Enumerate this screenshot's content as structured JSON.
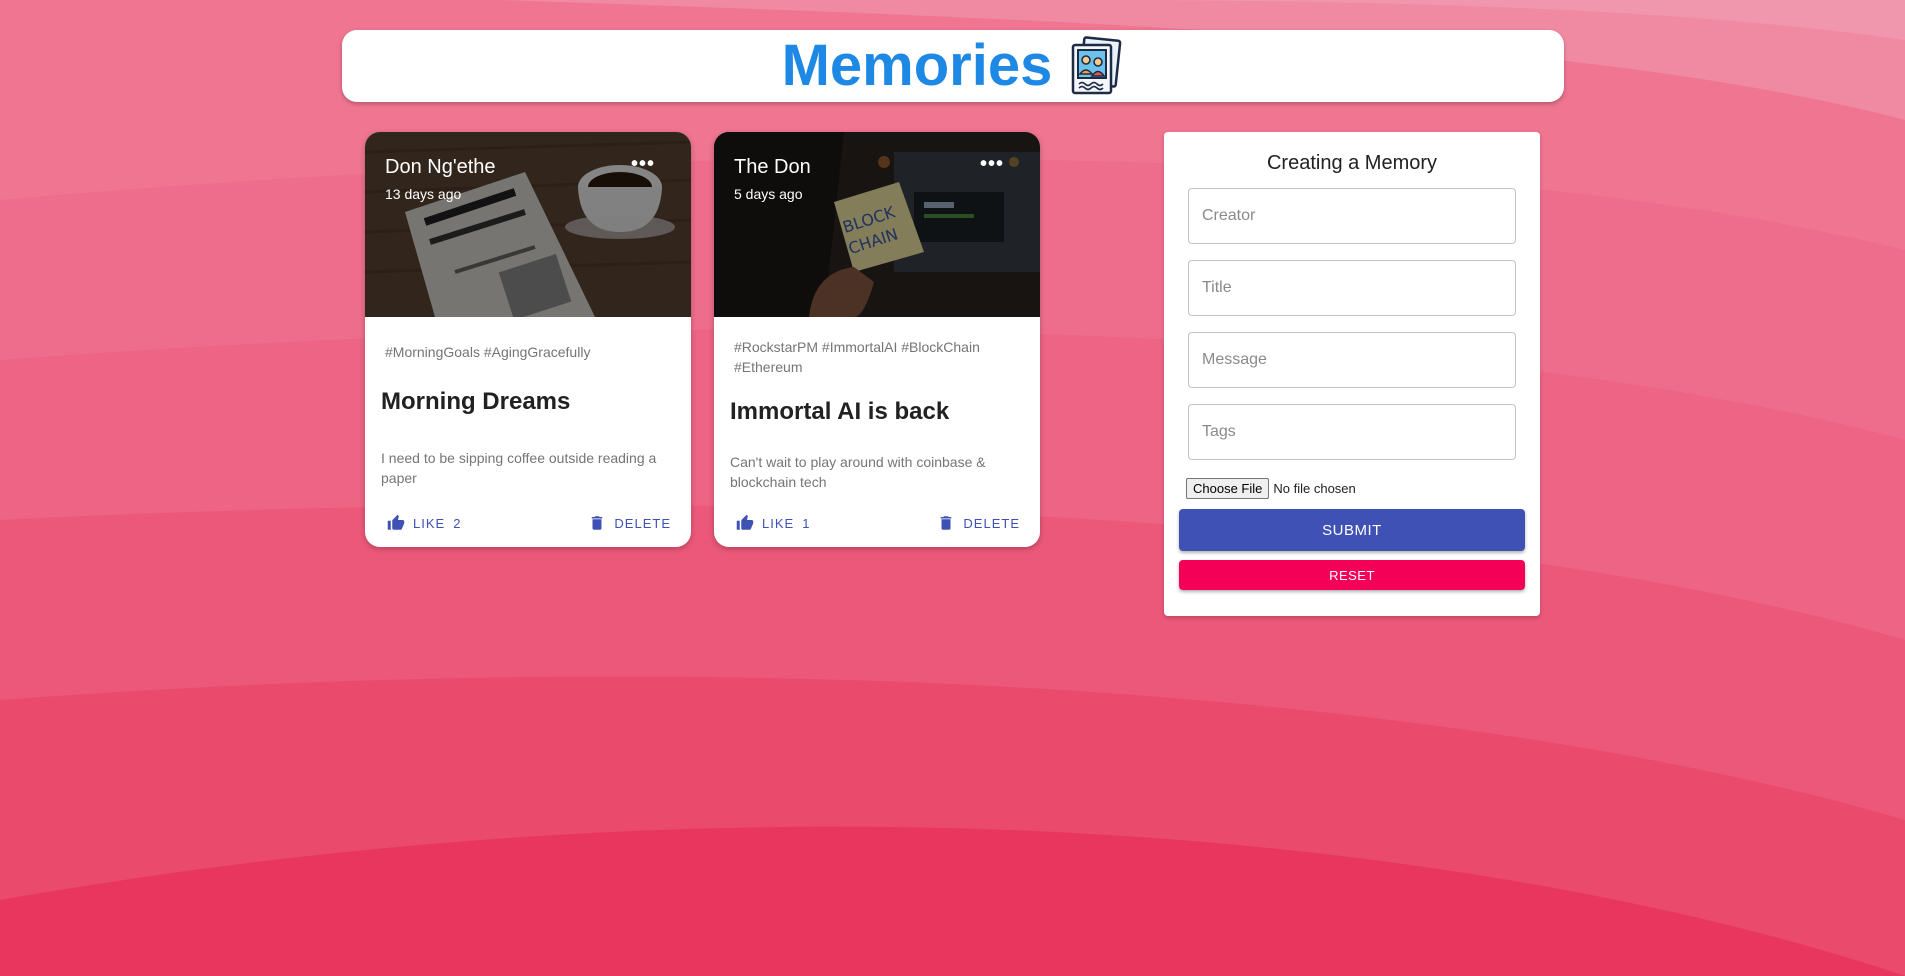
{
  "colors": {
    "accent": "#1e88e5",
    "primary": "#3f51b5",
    "secondary": "#f50057",
    "background": "#e8365f"
  },
  "appbar": {
    "title": "Memories",
    "logo_icon": "memories-photo-icon"
  },
  "posts": [
    {
      "creator": "Don Ng'ethe",
      "time": "13 days ago",
      "tags": "#MorningGoals #AgingGracefully",
      "title": "Morning Dreams",
      "message": "I need to be sipping coffee outside reading a paper",
      "like_label": "LIKE",
      "like_count": "2",
      "delete_label": "DELETE",
      "media": "newspaper-coffee-photo"
    },
    {
      "creator": "The Don",
      "time": "5 days ago",
      "tags": "#RockstarPM #ImmortalAI #BlockChain #Ethereum",
      "title": "Immortal AI is back",
      "message": "Can't wait to play around with coinbase & blockchain tech",
      "like_label": "LIKE",
      "like_count": "1",
      "delete_label": "DELETE",
      "media": "blockchain-sticky-note-photo"
    }
  ],
  "form": {
    "title": "Creating a Memory",
    "creator_placeholder": "Creator",
    "title_placeholder": "Title",
    "message_placeholder": "Message",
    "tags_placeholder": "Tags",
    "file_button": "Choose File",
    "file_status": "No file chosen",
    "submit_label": "SUBMIT",
    "reset_label": "RESET"
  }
}
